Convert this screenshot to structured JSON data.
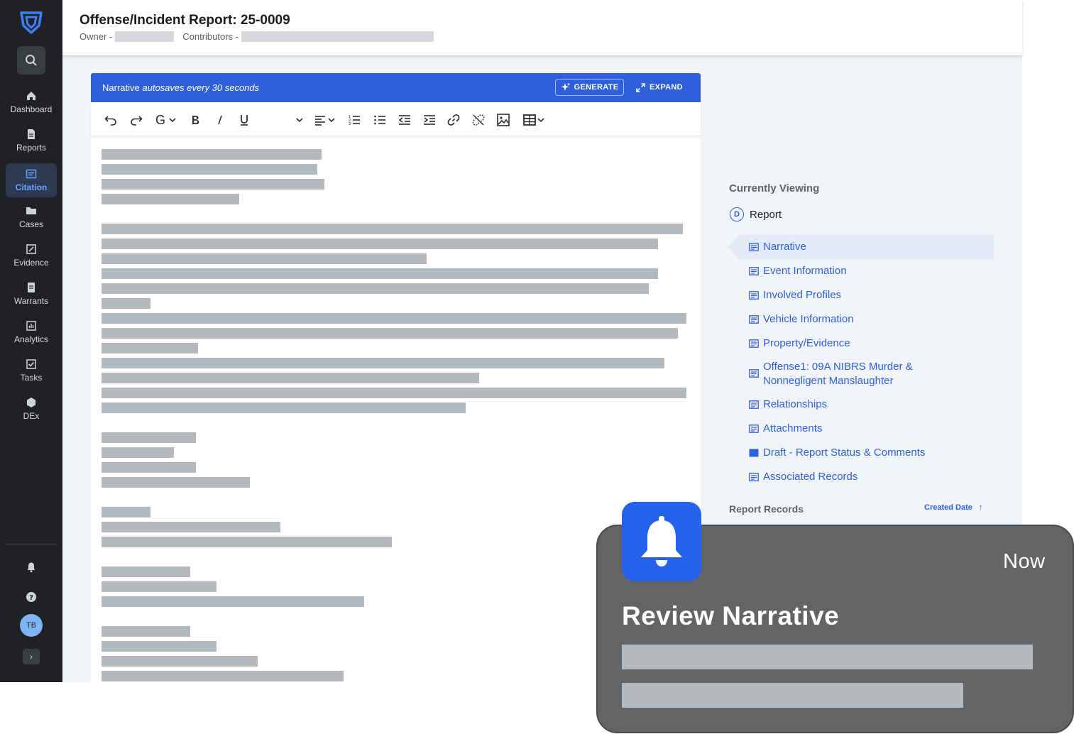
{
  "sidebar": {
    "items": [
      {
        "label": "Dashboard",
        "icon": "home-icon"
      },
      {
        "label": "Reports",
        "icon": "document-icon"
      },
      {
        "label": "Citation",
        "icon": "citation-icon"
      },
      {
        "label": "Cases",
        "icon": "folder-icon"
      },
      {
        "label": "Evidence",
        "icon": "evidence-icon"
      },
      {
        "label": "Warrants",
        "icon": "warrant-icon"
      },
      {
        "label": "Analytics",
        "icon": "analytics-icon"
      },
      {
        "label": "Tasks",
        "icon": "tasks-icon"
      },
      {
        "label": "DEx",
        "icon": "hexagon-icon"
      }
    ],
    "active": "Citation",
    "avatar_initials": "TB",
    "collapse_glyph": "›"
  },
  "header": {
    "title": "Offense/Incident Report: 25-0009",
    "owner_label": "Owner -",
    "contributors_label": "Contributors -"
  },
  "editor": {
    "banner_prefix": "Narrative",
    "banner_italic": "autosaves every 30 seconds",
    "generate_label": "GENERATE",
    "expand_label": "EXPAND",
    "font_glyph": "G"
  },
  "panel": {
    "currently_viewing": "Currently Viewing",
    "report_badge": "D",
    "report_label": "Report",
    "sections": [
      "Narrative",
      "Event Information",
      "Involved Profiles",
      "Vehicle Information",
      "Property/Evidence",
      "Offense1: 09A NIBRS Murder & Nonnegligent Manslaughter",
      "Relationships",
      "Attachments",
      "Draft - Report Status & Comments",
      "Associated Records"
    ],
    "selected": "Narrative",
    "report_records": "Report Records",
    "created_date": "Created Date",
    "sort_glyph": "↑"
  },
  "notification": {
    "time": "Now",
    "title": "Review Narrative"
  },
  "colors": {
    "accent": "#2e5fdc",
    "sidebar_bg": "#1f2125",
    "notif_bg": "#636466",
    "notif_icon_bg": "#2563eb",
    "redaction": "#b5b8bc"
  }
}
